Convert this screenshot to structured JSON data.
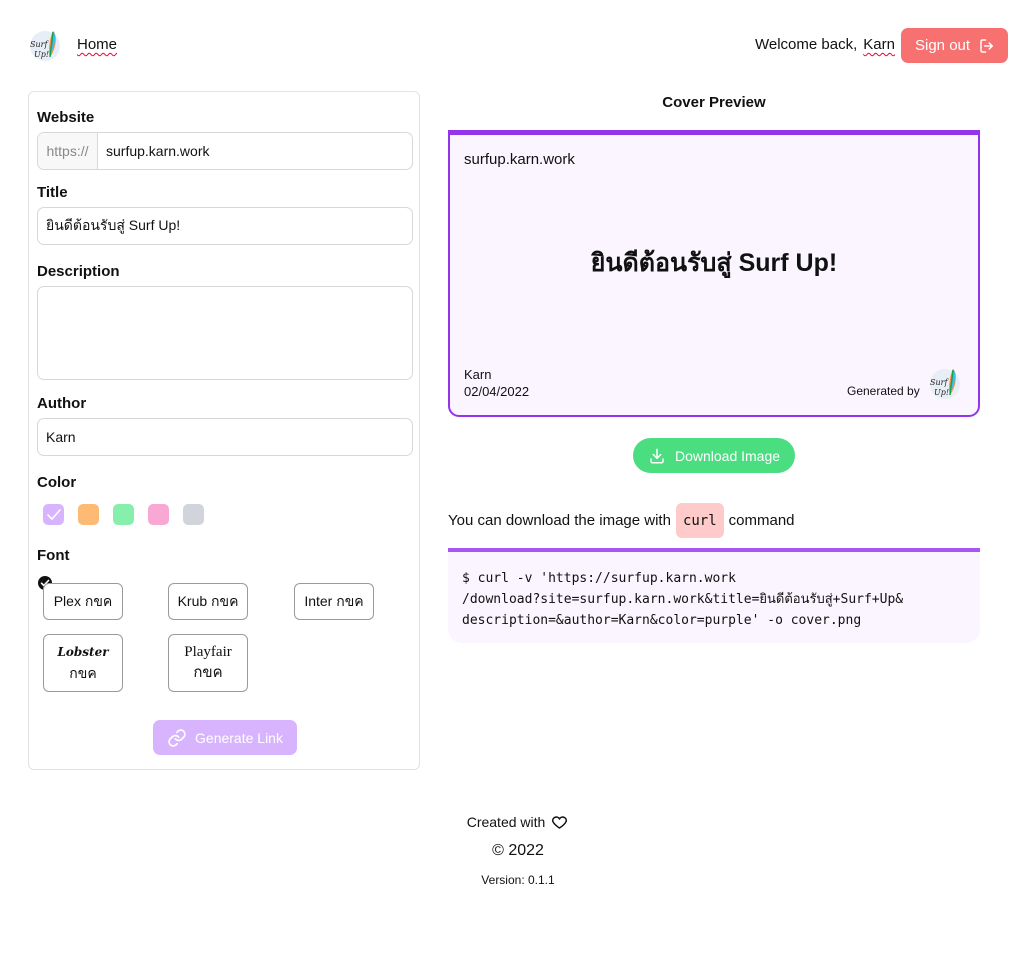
{
  "header": {
    "logo_text": "Surf Up!",
    "home_label": "Home",
    "welcome_text": "Welcome back,",
    "user_name": "Karn",
    "signout_label": "Sign out"
  },
  "form": {
    "website_label": "Website",
    "website_prefix": "https://",
    "website_value": "surfup.karn.work",
    "title_label": "Title",
    "title_value": "ยินดีต้อนรับสู่ Surf Up!",
    "description_label": "Description",
    "description_value": "",
    "author_label": "Author",
    "author_value": "Karn",
    "color_label": "Color",
    "colors": [
      {
        "name": "purple",
        "hex": "#d8b4fe",
        "selected": true
      },
      {
        "name": "orange",
        "hex": "#fdba74",
        "selected": false
      },
      {
        "name": "green",
        "hex": "#86efac",
        "selected": false
      },
      {
        "name": "pink",
        "hex": "#f9a8d4",
        "selected": false
      },
      {
        "name": "gray",
        "hex": "#d1d5db",
        "selected": false
      }
    ],
    "font_label": "Font",
    "fonts": [
      {
        "label": "Plex กขค",
        "selected": true
      },
      {
        "label": "Krub กขค",
        "selected": false
      },
      {
        "label": "Inter กขค",
        "selected": false
      },
      {
        "label_line1": "Lobster",
        "label_line2": "กขค",
        "selected": false
      },
      {
        "label_line1": "Playfair",
        "label_line2": "กขค",
        "selected": false
      }
    ],
    "generate_label": "Generate Link"
  },
  "preview": {
    "heading": "Cover Preview",
    "site": "surfup.karn.work",
    "title": "ยินดีต้อนรับสู่ Surf Up!",
    "author": "Karn",
    "date": "02/04/2022",
    "generated_by": "Generated by",
    "accent_color": "#9333ea",
    "download_label": "Download Image",
    "curl_prefix": "You can download the image with",
    "curl_code": "curl",
    "curl_suffix": "command",
    "command_line1": "$ curl -v 'https://surfup.karn.work",
    "command_line2": "/download?site=surfup.karn.work&title=ยินดีต้อนรับสู่+Surf+Up&",
    "command_line3": "description=&author=Karn&color=purple' -o cover.png"
  },
  "footer": {
    "created_with": "Created with",
    "copyright": "© 2022",
    "version": "Version: 0.1.1"
  }
}
